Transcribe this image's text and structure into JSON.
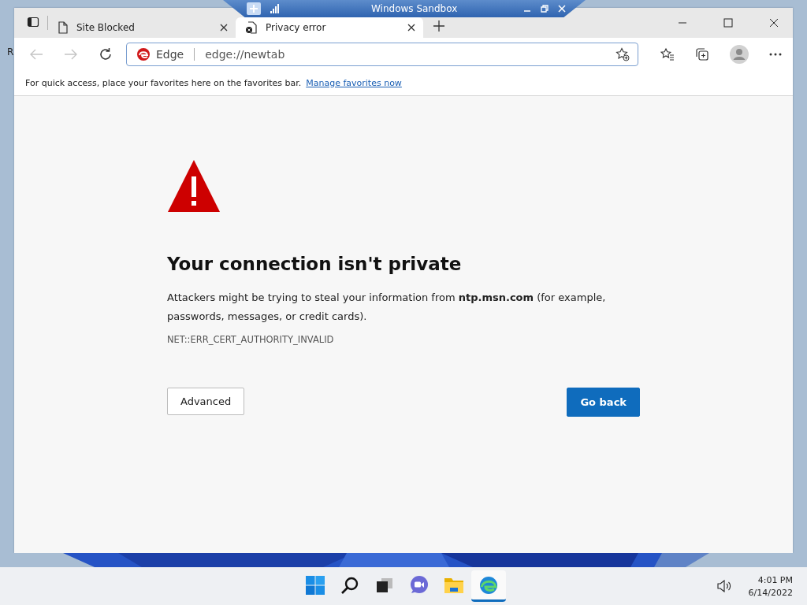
{
  "desktop": {
    "text_fragment": "R"
  },
  "sandbox_bar": {
    "title": "Windows Sandbox"
  },
  "tabs": [
    {
      "title": "Site Blocked",
      "selected": false,
      "kind": "page"
    },
    {
      "title": "Privacy error",
      "selected": true,
      "kind": "error"
    }
  ],
  "address_bar": {
    "site_label": "Edge",
    "value": "edge://newtab"
  },
  "favorites_bar": {
    "message": "For quick access, place your favorites here on the favorites bar.",
    "link": "Manage favorites now"
  },
  "error": {
    "title": "Your connection isn't private",
    "message": "Attackers might be trying to steal your information from **ntp.msn.com** (for example, passwords, messages, or credit cards).",
    "code": "NET::ERR_CERT_AUTHORITY_INVALID",
    "buttons": [
      {
        "label": "Advanced",
        "kind": "secondary"
      },
      {
        "label": "Go back",
        "kind": "primary"
      }
    ]
  },
  "taskbar": {
    "apps": [
      {
        "kind": "start",
        "active": false
      },
      {
        "kind": "search",
        "active": false
      },
      {
        "kind": "task-view",
        "active": false
      },
      {
        "kind": "chat",
        "active": false
      },
      {
        "kind": "explorer",
        "active": false
      },
      {
        "kind": "edge",
        "active": true
      }
    ],
    "time": "4:01 PM",
    "date": "6/14/2022"
  }
}
